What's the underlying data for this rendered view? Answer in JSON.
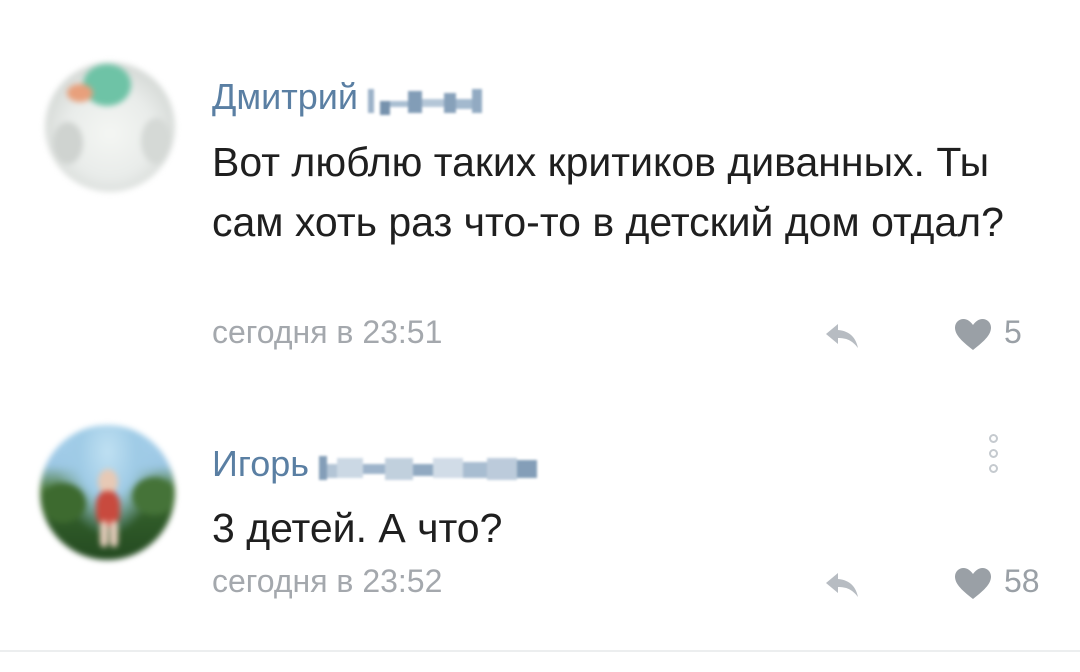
{
  "comments": [
    {
      "author": "Дмитрий",
      "text": "Вот люблю таких критиков диванных. Ты сам хоть раз что-то в детский дом отдал?",
      "time": "сегодня в 23:51",
      "likes": "5"
    },
    {
      "author": "Игорь",
      "text": "3 детей. А что?",
      "time": "сегодня в 23:52",
      "likes": "58"
    }
  ],
  "colors": {
    "author": "#5a7fa3",
    "meta": "#a4a8ad",
    "text": "#1f1f1f"
  },
  "icons": {
    "reply": "reply-arrow-icon",
    "like": "heart-icon",
    "more": "vertical-dots-icon"
  }
}
